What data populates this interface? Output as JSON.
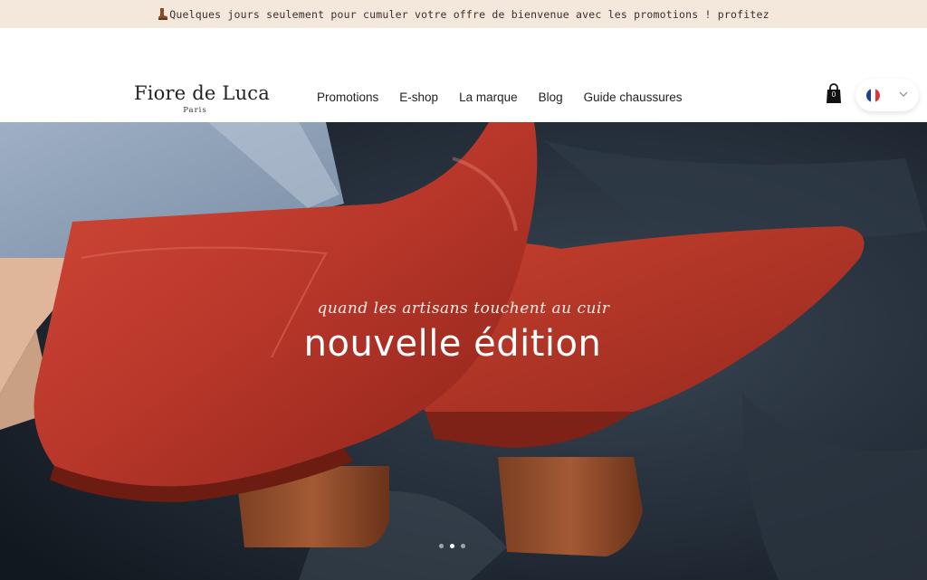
{
  "promo": {
    "icon": "boot-icon",
    "text": "Quelques jours seulement pour cumuler votre offre de bienvenue avec les promotions ! profitez"
  },
  "header": {
    "logo_name": "Fiore de Luca",
    "logo_sub": "Paris",
    "nav": [
      "Promotions",
      "E-shop",
      "La marque",
      "Blog",
      "Guide chaussures"
    ],
    "cart_count": "0",
    "language_flag": "france-flag-icon"
  },
  "hero": {
    "tagline": "quand les artisans touchent au cuir",
    "title": "nouvelle édition",
    "slides": 3,
    "active_slide": 2
  },
  "colors": {
    "promo_bg": "#f4e7dc",
    "boot_red": "#b8362a",
    "velvet": "#1e2631",
    "flag_blue": "#1f3d99",
    "flag_red": "#e0323c"
  }
}
